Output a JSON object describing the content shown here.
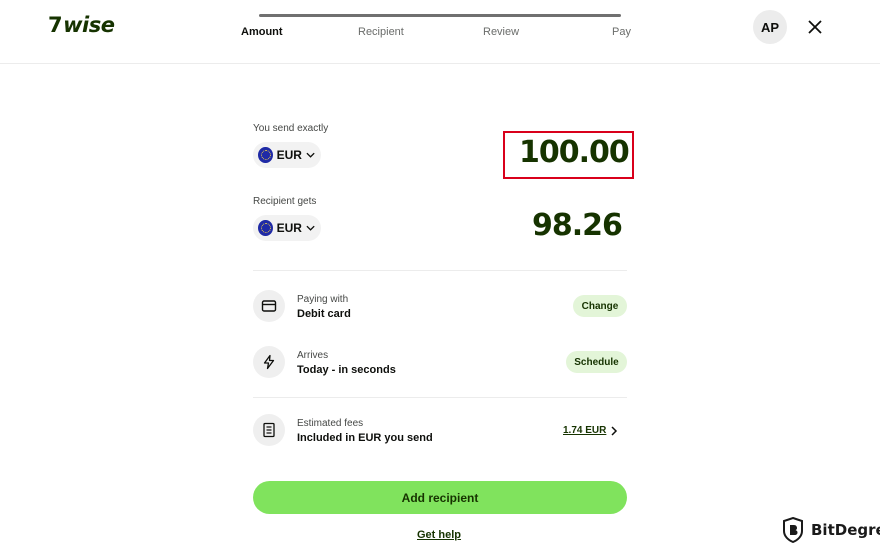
{
  "brand": {
    "logo_text": "wise",
    "logo_mark": "7"
  },
  "progress": {
    "steps": [
      "Amount",
      "Recipient",
      "Review",
      "Pay"
    ],
    "active_index": 0
  },
  "user": {
    "initials": "AP"
  },
  "send": {
    "label": "You send exactly",
    "currency": "EUR",
    "amount": "100.00"
  },
  "receive": {
    "label": "Recipient gets",
    "currency": "EUR",
    "amount": "98.26"
  },
  "details": {
    "paying": {
      "sub": "Paying with",
      "main": "Debit card",
      "action": "Change",
      "icon": "card-icon"
    },
    "arrives": {
      "sub": "Arrives",
      "main": "Today - in seconds",
      "action": "Schedule",
      "icon": "lightning-icon"
    },
    "fees": {
      "sub": "Estimated fees",
      "main": "Included in EUR you send",
      "amount": "1.74 EUR",
      "icon": "receipt-icon"
    }
  },
  "actions": {
    "primary": "Add recipient",
    "help": "Get help"
  },
  "watermark": {
    "text": "BitDegree"
  },
  "colors": {
    "brand_dark": "#163300",
    "brand_green": "#80e35d",
    "pill_bg": "#e3f5d8",
    "highlight": "#d9001b"
  }
}
